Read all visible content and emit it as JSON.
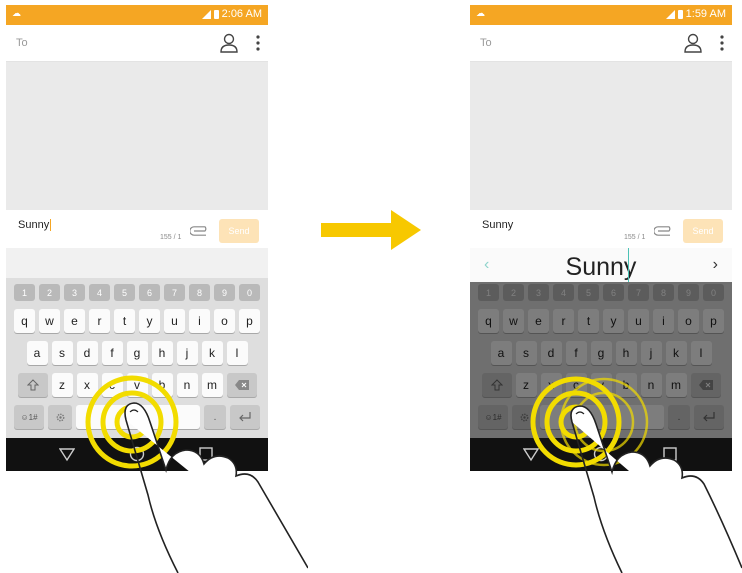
{
  "arrow_color": "#f7c800",
  "accent_color": "#f5a623",
  "ring_color": "#f2dc00",
  "left_phone": {
    "status_time": "2:06 AM",
    "to_placeholder": "To",
    "message_text": "Sunny",
    "char_counter": "155 / 1",
    "send_label": "Send",
    "icons": [
      "contact-icon",
      "more-vert-icon",
      "attach-icon",
      "back-icon",
      "home-icon",
      "recent-apps-icon"
    ]
  },
  "right_phone": {
    "status_time": "1:59 AM",
    "to_placeholder": "To",
    "message_text": "Sunny",
    "char_counter": "155 / 1",
    "send_label": "Send",
    "suggestion": "Sunny",
    "suggestion_prev": "‹",
    "suggestion_next": "›"
  },
  "keyboard": {
    "numbers": [
      "1",
      "2",
      "3",
      "4",
      "5",
      "6",
      "7",
      "8",
      "9",
      "0"
    ],
    "row1": [
      "q",
      "w",
      "e",
      "r",
      "t",
      "y",
      "u",
      "i",
      "o",
      "p"
    ],
    "row2": [
      "a",
      "s",
      "d",
      "f",
      "g",
      "h",
      "j",
      "k",
      "l"
    ],
    "row3": [
      "z",
      "x",
      "c",
      "v",
      "b",
      "n",
      "m"
    ],
    "symbols_key": "☺1#",
    "period_key": "."
  }
}
